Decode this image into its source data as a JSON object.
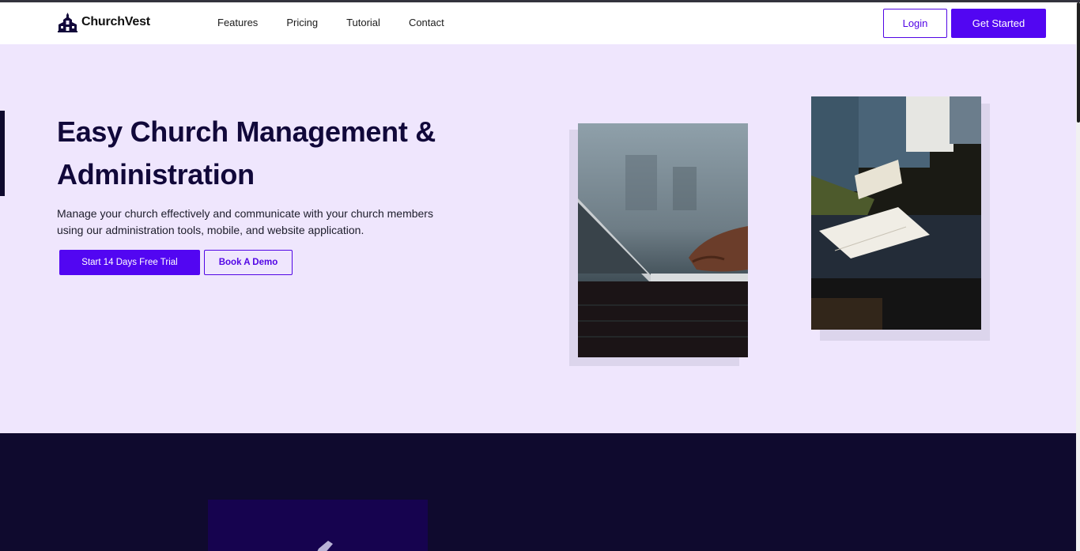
{
  "brand": {
    "name": "ChurchVest",
    "logo_icon": "church-building-icon"
  },
  "nav": {
    "links": [
      "Features",
      "Pricing",
      "Tutorial",
      "Contact"
    ],
    "login_label": "Login",
    "get_started_label": "Get Started"
  },
  "hero": {
    "title_line1": "Easy Church Management &",
    "title_line2": "Administration",
    "description": "Manage your church effectively and communicate with your church members using our administration tools, mobile, and website application.",
    "primary_cta": "Start 14 Days Free Trial",
    "secondary_cta": "Book A Demo",
    "images": [
      "laptop-typing-photo",
      "congregation-bible-photo"
    ]
  },
  "colors": {
    "accent": "#5206f2",
    "hero_bg": "#efe6fd",
    "heading": "#11083a",
    "dark_bg": "#0f0a2e",
    "card_bg": "#16034f"
  }
}
